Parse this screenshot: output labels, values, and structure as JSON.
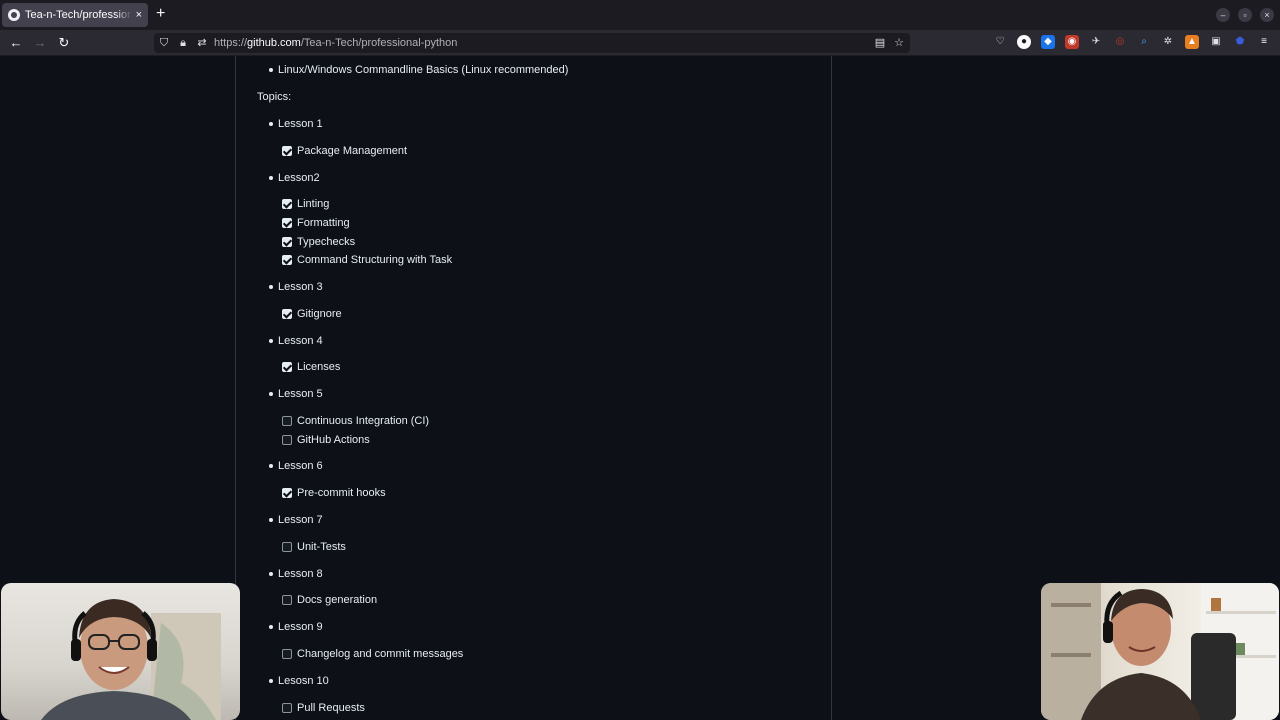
{
  "browser": {
    "tab_title": "Tea-n-Tech/professional-python",
    "tab_close": "×",
    "new_tab": "+",
    "url_scheme": "https://",
    "url_host": "github.com",
    "url_path": "/Tea-n-Tech/professional-python",
    "window_controls": [
      "–",
      "▫",
      "×"
    ]
  },
  "readme": {
    "top_item": "Linux/Windows Commandline Basics (Linux recommended)",
    "topics_label": "Topics:",
    "lessons": [
      {
        "title": "Lesson 1",
        "items": [
          {
            "label": "Package Management",
            "checked": true
          }
        ]
      },
      {
        "title": "Lesson2",
        "items": [
          {
            "label": "Linting",
            "checked": true
          },
          {
            "label": "Formatting",
            "checked": true
          },
          {
            "label": "Typechecks",
            "checked": true
          },
          {
            "label": "Command Structuring with Task",
            "checked": true
          }
        ]
      },
      {
        "title": "Lesson 3",
        "items": [
          {
            "label": "Gitignore",
            "checked": true
          }
        ]
      },
      {
        "title": "Lesson 4",
        "items": [
          {
            "label": "Licenses",
            "checked": true
          }
        ]
      },
      {
        "title": "Lesson 5",
        "items": [
          {
            "label": "Continuous Integration (CI)",
            "checked": false
          },
          {
            "label": "GitHub Actions",
            "checked": false
          }
        ]
      },
      {
        "title": "Lesson 6",
        "items": [
          {
            "label": "Pre-commit hooks",
            "checked": true
          }
        ]
      },
      {
        "title": "Lesson 7",
        "items": [
          {
            "label": "Unit-Tests",
            "checked": false
          }
        ]
      },
      {
        "title": "Lesson 8",
        "items": [
          {
            "label": "Docs generation",
            "checked": false
          }
        ]
      },
      {
        "title": "Lesson 9",
        "items": [
          {
            "label": "Changelog and commit messages",
            "checked": false
          }
        ]
      },
      {
        "title": "Lesosn 10",
        "items": [
          {
            "label": "Pull Requests",
            "checked": false
          }
        ]
      }
    ]
  }
}
